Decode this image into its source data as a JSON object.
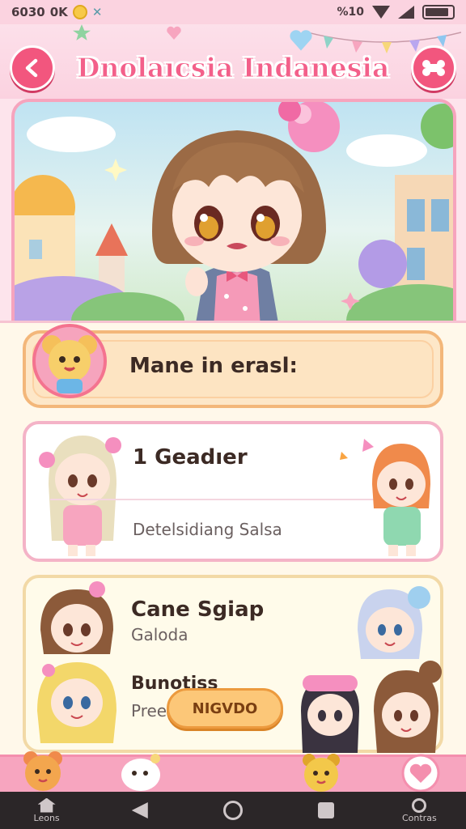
{
  "status_bar": {
    "time": "6030",
    "carrier": "0K",
    "right_text": "%10"
  },
  "header": {
    "title": "Dnolaıcsia Indanesia"
  },
  "name_bar": {
    "label": "Mane in erasl:"
  },
  "card_1": {
    "title": "1 Geadıer",
    "subtitle": "Detelsidiang Salsa"
  },
  "card_2": {
    "title": "Cane Sgiap",
    "subtitle": "Galoda",
    "title_2": "Bunotiss",
    "subtitle_2": "Preec"
  },
  "action_button": {
    "label": "NIGVDO"
  },
  "nav": {
    "left_label": "Leons",
    "right_label": "Contras"
  },
  "colors": {
    "accent_pink": "#f2567e",
    "title_pink": "#f3608a",
    "button_orange": "#fcc778",
    "dock_pink": "#f7a5bf"
  }
}
